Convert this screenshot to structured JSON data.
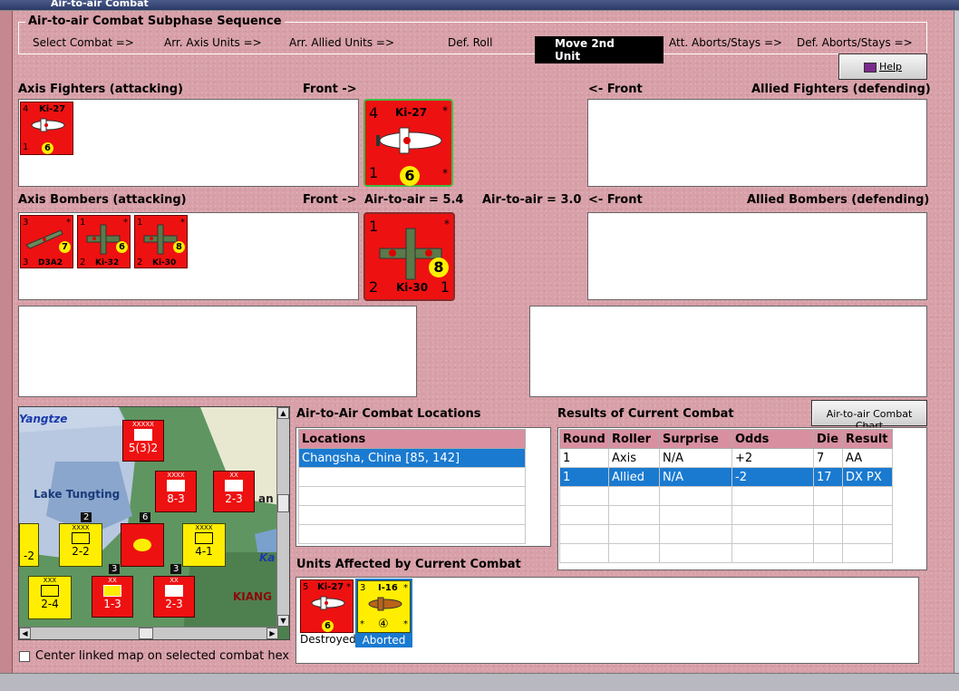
{
  "window": {
    "title": "Air-to-air Combat"
  },
  "sequence": {
    "title": "Air-to-air Combat Subphase Sequence",
    "steps": [
      "Select Combat =>",
      "Arr. Axis Units =>",
      "Arr. Allied Units =>",
      "Def. Roll",
      "Move 2nd Unit",
      "Att. Aborts/Stays =>",
      "Def. Aborts/Stays =>"
    ],
    "active": "Move 2nd Unit"
  },
  "help": {
    "label": "Help"
  },
  "axis_fighters": {
    "label": "Axis Fighters (attacking)",
    "front": "Front ->"
  },
  "allied_fighters": {
    "label": "Allied Fighters (defending)",
    "front": "<- Front"
  },
  "axis_bombers": {
    "label": "Axis Bombers (attacking)",
    "front": "Front ->"
  },
  "allied_bombers": {
    "label": "Allied Bombers (defending)",
    "front": "<- Front"
  },
  "air_to_air_axis": "Air-to-air = 5.4",
  "air_to_air_allied": "Air-to-air = 3.0",
  "counters": {
    "fighter_small": {
      "name": "Ki-27",
      "tl": "4",
      "bl": "1",
      "value": "6",
      "tr": "*"
    },
    "fighter_big": {
      "name": "Ki-27",
      "tl": "4",
      "bl": "1",
      "value": "6",
      "tr": "*",
      "br": "*"
    },
    "bombers": [
      {
        "name": "D3A2",
        "tl": "3",
        "bl": "3",
        "value": "7",
        "tr": "*",
        "br": ""
      },
      {
        "name": "Ki-32",
        "tl": "1",
        "bl": "2",
        "value": "6",
        "tr": "*",
        "br": ""
      },
      {
        "name": "Ki-30",
        "tl": "1",
        "bl": "2",
        "value": "8",
        "tr": "*",
        "br": ""
      }
    ],
    "bomber_big": {
      "name": "Ki-30",
      "tl": "1",
      "bl": "2",
      "value": "8",
      "tr": "*",
      "br": "1"
    }
  },
  "locations": {
    "title": "Air-to-Air Combat Locations",
    "header": "Locations",
    "rows": [
      "Changsha, China [85, 142]",
      "",
      "",
      "",
      ""
    ]
  },
  "results": {
    "title": "Results of Current Combat",
    "chart_button": "Air-to-air Combat Chart",
    "columns": [
      "Round",
      "Roller",
      "Surprise",
      "Odds",
      "Die",
      "Result"
    ],
    "rows": [
      [
        "1",
        "Axis",
        "N/A",
        "+2",
        "7",
        "AA"
      ],
      [
        "1",
        "Allied",
        "N/A",
        "-2",
        "17",
        "DX PX"
      ],
      [
        "",
        "",
        "",
        "",
        "",
        ""
      ],
      [
        "",
        "",
        "",
        "",
        "",
        ""
      ],
      [
        "",
        "",
        "",
        "",
        "",
        ""
      ],
      [
        "",
        "",
        "",
        "",
        "",
        ""
      ]
    ]
  },
  "units_affected": {
    "title": "Units Affected by Current Combat",
    "units": [
      {
        "name": "Ki-27",
        "tl": "5",
        "value": "6",
        "tr": "*",
        "status": "Destroyed"
      },
      {
        "name": "I-16",
        "tl": "3",
        "value": "④",
        "tr": "*",
        "bl": "*",
        "br": "*",
        "status": "Aborted"
      }
    ]
  },
  "map": {
    "labels": {
      "river": "Yangtze",
      "lake": "Lake Tungting",
      "region": "KIANG",
      "ka": "Ka",
      "an": "an"
    },
    "units": [
      {
        "name": "XXXXX",
        "value": "5(3)2",
        "color": "#ee1111"
      },
      {
        "name": "XXXX",
        "value": "8-3",
        "color": "#ee1111"
      },
      {
        "name": "XX",
        "value": "2-3",
        "color": "#ee1111"
      },
      {
        "name": "XXXX",
        "value": "2-2",
        "color": "#ffee00"
      },
      {
        "name": "XXXX",
        "value": "4-1",
        "color": "#ffee00"
      },
      {
        "name": "XXX",
        "value": "2-4",
        "color": "#ffee00"
      },
      {
        "name": "XX",
        "value": "1-3",
        "color": "#ee1111"
      },
      {
        "name": "XX",
        "value": "2-3",
        "color": "#ee1111"
      },
      {
        "name": "",
        "value": "-2",
        "color": "#ffee00"
      }
    ],
    "stack_labels": [
      "2",
      "6",
      "3",
      "3"
    ]
  },
  "center_linked": {
    "label": "Center linked map on selected combat hex",
    "checked": false
  }
}
